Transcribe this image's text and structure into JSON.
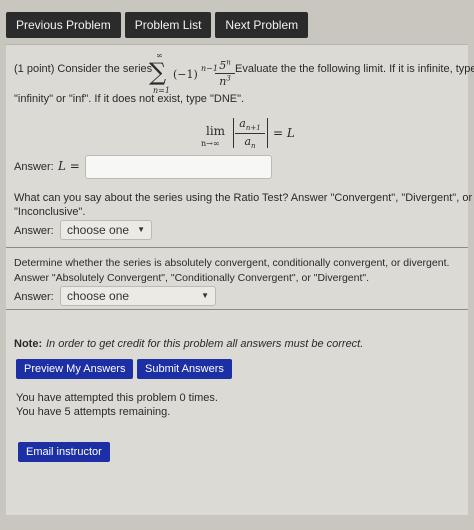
{
  "nav": {
    "previous_label": "Previous Problem",
    "list_label": "Problem List",
    "next_label": "Next Problem"
  },
  "problem": {
    "intro": "(1 point) Consider the series",
    "series_upper": "∞",
    "series_lower": "n=1",
    "series_term": "(−1)",
    "series_exponent": "n−1",
    "series_numerator": "5",
    "series_numerator_exp": "n",
    "series_denominator": "n",
    "series_denominator_exp": "3",
    "instruction_1": "Evaluate the the following limit. If it is infinite, type",
    "instruction_2": "\"infinity\" or \"inf\". If it does not exist, type \"DNE\".",
    "lim_label": "lim",
    "lim_sub": "n→∞",
    "ratio_num": "a",
    "ratio_num_sub": "n+1",
    "ratio_den": "a",
    "ratio_den_sub": "n",
    "equals_L": "= L",
    "answer_prefix": "Answer:",
    "answer_L": "L =",
    "answer_value": "",
    "ratio_question_1": "What can you say about the series using the Ratio Test? Answer \"Convergent\", \"Divergent\", or",
    "ratio_question_2": "\"Inconclusive\".",
    "answer_label": "Answer:",
    "ratio_select": "choose one",
    "determine_1": "Determine whether the series is absolutely convergent, conditionally convergent, or divergent.",
    "determine_2": "Answer \"Absolutely Convergent\", \"Conditionally Convergent\", or \"Divergent\".",
    "convergence_select": "choose one"
  },
  "note": {
    "label": "Note:",
    "text": "In order to get credit for this problem all answers must be correct."
  },
  "actions": {
    "preview_label": "Preview My Answers",
    "submit_label": "Submit Answers"
  },
  "status": {
    "attempted": "You have attempted this problem 0 times.",
    "remaining": "You have 5 attempts remaining."
  },
  "email_label": "Email instructor",
  "colors": {
    "nav_button": "#2b2b2b",
    "action_button": "#1d2fa4",
    "panel": "#dcdad4"
  }
}
